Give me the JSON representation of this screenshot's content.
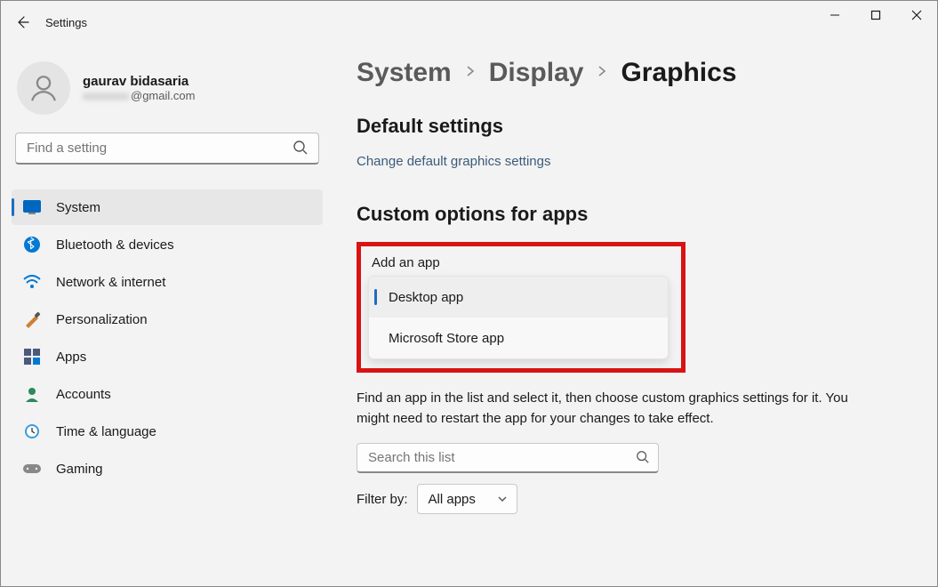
{
  "window": {
    "title": "Settings"
  },
  "profile": {
    "name": "gaurav bidasaria",
    "email_domain": "@gmail.com"
  },
  "search": {
    "placeholder": "Find a setting"
  },
  "nav": [
    {
      "key": "system",
      "label": "System",
      "active": true
    },
    {
      "key": "bluetooth",
      "label": "Bluetooth & devices"
    },
    {
      "key": "network",
      "label": "Network & internet"
    },
    {
      "key": "personalization",
      "label": "Personalization"
    },
    {
      "key": "apps",
      "label": "Apps"
    },
    {
      "key": "accounts",
      "label": "Accounts"
    },
    {
      "key": "time",
      "label": "Time & language"
    },
    {
      "key": "gaming",
      "label": "Gaming"
    }
  ],
  "breadcrumb": {
    "items": [
      "System",
      "Display",
      "Graphics"
    ]
  },
  "sections": {
    "default": {
      "title": "Default settings",
      "link": "Change default graphics settings"
    },
    "custom": {
      "title": "Custom options for apps",
      "add_label": "Add an app",
      "dropdown": {
        "options": [
          "Desktop app",
          "Microsoft Store app"
        ],
        "selected_index": 0
      },
      "help": "Find an app in the list and select it, then choose custom graphics settings for it. You might need to restart the app for your changes to take effect.",
      "search_placeholder": "Search this list",
      "filter_label": "Filter by:",
      "filter_value": "All apps"
    }
  }
}
